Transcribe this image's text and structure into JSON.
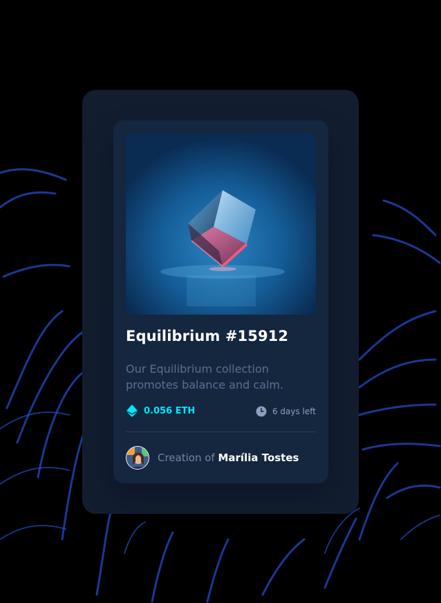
{
  "card": {
    "title": "Equilibrium #15912",
    "description": "Our Equilibrium collection promotes balance and calm.",
    "price": "0.056 ETH",
    "time_left": "6 days left",
    "creator_prefix": "Creation of",
    "creator_name": "Marília Tostes"
  },
  "colors": {
    "background": "#000000",
    "outer_panel": "#121d30",
    "card": "#15263f",
    "accent_cyan": "#00e7ff",
    "muted_text": "#5a7090",
    "divider": "#2e405a"
  },
  "icons": {
    "price": "ethereum-icon",
    "time": "clock-icon",
    "avatar": "creator-avatar"
  }
}
